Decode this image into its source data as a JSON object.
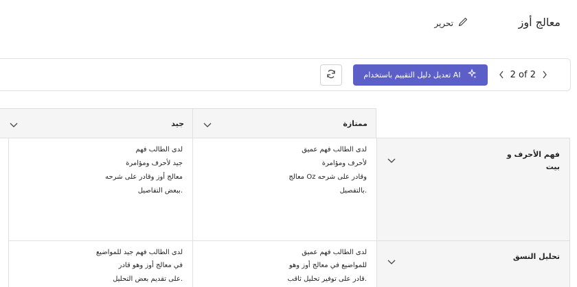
{
  "header": {
    "title": "معالج أوز",
    "edit_label": "تحرير"
  },
  "toolbar": {
    "page_indicator": "2 of 2",
    "ai_button_label": "تعديل دليل التقييم باستخدام AI"
  },
  "rubric": {
    "columns": [
      {
        "label": "ممتازة"
      },
      {
        "label": "جيد"
      }
    ],
    "rows": [
      {
        "label": "فهم الأحرف و بيت",
        "cells": [
          [
            "لدى الطالب فهم عميق",
            "لأحرف ومؤامرة",
            "معالج Oz وقادر على شرحه",
            "بالتفصيل."
          ],
          [
            "لدى الطالب فهم",
            "جيد لأحرف ومؤامرة",
            "معالج أوز وقادر على شرحه",
            "ببعض التفاصيل."
          ]
        ]
      },
      {
        "label": "تحليل النسق",
        "cells": [
          [
            "لدى الطالب فهم عميق",
            "للمواضيع في معالج أوز وهو",
            "قادر على توفير تحليل ثاقب."
          ],
          [
            "لدى الطالب فهم جيد للمواضيع",
            "في معالج أوز وهو قادر",
            "على تقديم بعض التحليل."
          ]
        ]
      }
    ]
  },
  "colors": {
    "accent": "#5b5fc7",
    "header_bg": "#f5f5f5",
    "border": "#e0e0e0"
  }
}
